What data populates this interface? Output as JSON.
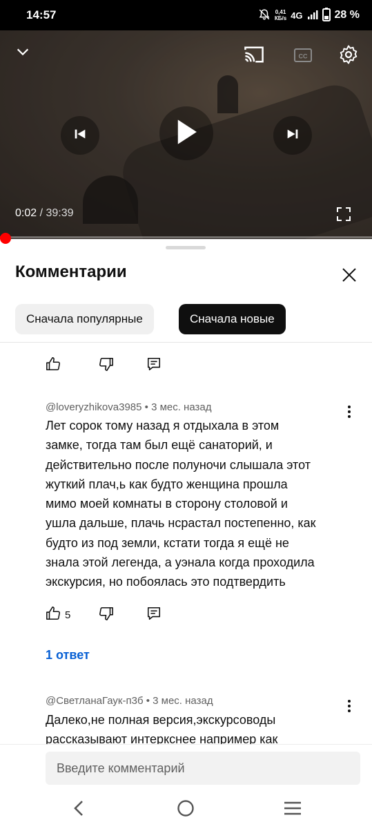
{
  "status": {
    "time": "14:57",
    "net_speed_value": "0,41",
    "net_speed_unit": "КБ/s",
    "network": "4G",
    "battery": "28 %"
  },
  "player": {
    "current_time": "0:02",
    "separator": " / ",
    "duration": "39:39",
    "progress_fraction": 0.001
  },
  "comments_panel": {
    "title": "Комментарии",
    "sort_chips": [
      {
        "label": "Сначала популярные",
        "selected": false
      },
      {
        "label": "Сначала новые",
        "selected": true
      }
    ],
    "comments": [
      {
        "author": "@loveryzhikova3985",
        "age": "3 мес. назад",
        "text": "Лет сорок тому назад я отдыхала в этом замке, тогда там был ещё санаторий, и действительно после полуночи слышала этот жуткий плач,ь как будто женщина прошла мимо моей комнаты в сторону столовой и ушла дальше, плачь нсрастал постепенно, как будто из под земли, кстати тогда я ещё не знала этой легенда, а уэнала когда проходила экскурсия, но побоялась это подтвердить",
        "lines": [
          "Лет сорок тому назад я отдыхала в этом",
          "замке, тогда там был ещё санаторий, и",
          "действительно после полуночи слышала этот",
          "жуткий плач,ь как будто женщина прошла",
          "мимо моей комнаты в сторону столовой и",
          "ушла дальше, плачь нсрастал постепенно, как",
          "будто из под земли, кстати тогда я ещё не",
          "знала этой легенда, а уэнала когда проходила",
          "экскурсия, но побоялась это подтвердить"
        ],
        "likes": "5",
        "replies_label": "1 ответ"
      },
      {
        "author": "@СветланаГаук-п3б",
        "age": "3 мес. назад",
        "lines": [
          "Далеко,не полная версия,экскурсоводы",
          "рассказывают интеркснее например как"
        ]
      }
    ],
    "input_placeholder": "Введите комментарий"
  },
  "colors": {
    "accent_red": "#ff0000",
    "link_blue": "#065fd4",
    "chip_selected": "#0f0f0f",
    "chip_default": "#f0f0f0"
  },
  "icons": [
    "mute-icon",
    "signal-icon",
    "battery-icon",
    "chevron-down-icon",
    "cast-icon",
    "captions-icon",
    "settings-icon",
    "previous-icon",
    "play-icon",
    "next-icon",
    "fullscreen-icon",
    "close-icon",
    "thumbs-up-icon",
    "thumbs-down-icon",
    "reply-icon",
    "more-vert-icon",
    "back-icon",
    "home-icon",
    "recents-icon"
  ]
}
